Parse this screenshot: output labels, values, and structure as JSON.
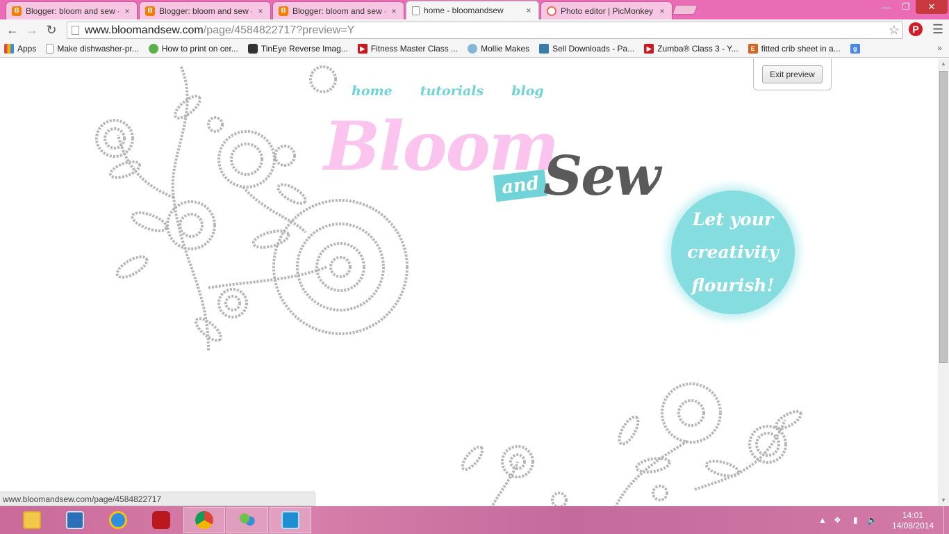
{
  "browser": {
    "tabs": [
      {
        "title": "Blogger: bloom and sew -",
        "icon": "blogger-icon"
      },
      {
        "title": "Blogger: bloom and sew -",
        "icon": "blogger-icon"
      },
      {
        "title": "Blogger: bloom and sew -",
        "icon": "blogger-icon"
      },
      {
        "title": "home - bloomandsew",
        "icon": "page-icon",
        "active": true
      },
      {
        "title": "Photo editor | PicMonkey:",
        "icon": "picmonkey-icon"
      }
    ],
    "tab_close": "×",
    "url_host": "www.bloomandsew.com",
    "url_path": "/page/4584822717?preview=Y",
    "bookmarks": [
      {
        "label": "Apps",
        "icon": "apps-icon"
      },
      {
        "label": "Make dishwasher-pr...",
        "icon": "page-icon"
      },
      {
        "label": "How to print on cer...",
        "icon": "leaf-icon"
      },
      {
        "label": "TinEye Reverse Imag...",
        "icon": "tineye-icon"
      },
      {
        "label": "Fitness Master Class ...",
        "icon": "youtube-icon"
      },
      {
        "label": "Mollie Makes",
        "icon": "mollie-icon"
      },
      {
        "label": "Sell Downloads - Pa...",
        "icon": "sell-downloads-icon"
      },
      {
        "label": "Zumba® Class 3 - Y...",
        "icon": "youtube-icon"
      },
      {
        "label": "fitted crib sheet in a...",
        "icon": "etsy-icon"
      },
      {
        "label": "",
        "icon": "google-icon"
      }
    ],
    "bookmarks_more": "»",
    "status_url": "www.bloomandsew.com/page/4584822717"
  },
  "page": {
    "nav": [
      "home",
      "tutorials",
      "blog"
    ],
    "logo": {
      "bloom": "Bloom",
      "and": "and",
      "sew": "Sew"
    },
    "badge_lines": [
      "Let your",
      "creativity",
      "flourish!"
    ],
    "exit_preview": "Exit preview"
  },
  "taskbar": {
    "time": "14:01",
    "date": "14/08/2014",
    "apps": [
      "file-explorer-icon",
      "control-panel-icon",
      "internet-explorer-icon",
      "power-icon",
      "chrome-icon",
      "messenger-icon",
      "photo-viewer-icon"
    ]
  },
  "colors": {
    "tabstrip": "#e96cb4",
    "bloom_pink": "#fbc4ef",
    "teal": "#6fd3d8",
    "sew_gray": "#5a5a5a"
  }
}
